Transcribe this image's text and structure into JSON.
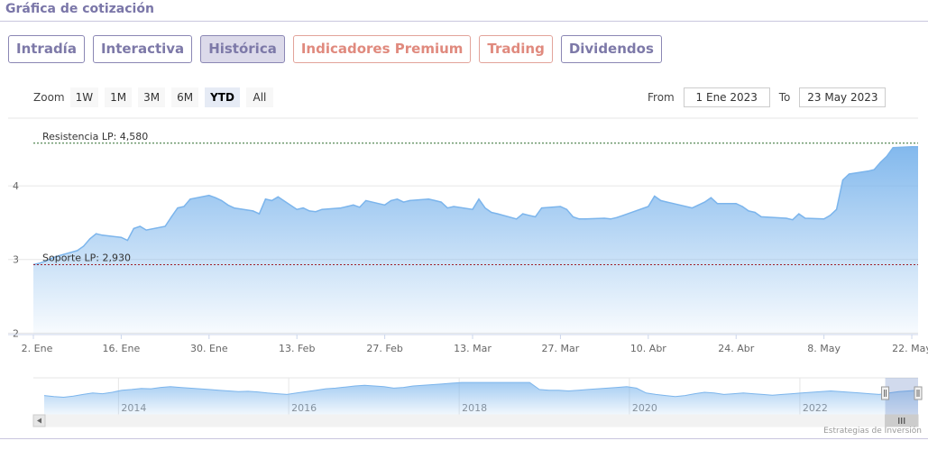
{
  "header": {
    "title": "Gráfica de cotización"
  },
  "tabs": [
    {
      "label": "Intradía",
      "active": false,
      "premium": false
    },
    {
      "label": "Interactiva",
      "active": false,
      "premium": false
    },
    {
      "label": "Histórica",
      "active": true,
      "premium": false
    },
    {
      "label": "Indicadores Premium",
      "active": false,
      "premium": true
    },
    {
      "label": "Trading",
      "active": false,
      "premium": true
    },
    {
      "label": "Dividendos",
      "active": false,
      "premium": false
    }
  ],
  "range_selector": {
    "zoom_label": "Zoom",
    "buttons": [
      "1W",
      "1M",
      "3M",
      "6M",
      "YTD",
      "All"
    ],
    "selected": "YTD",
    "from_label": "From",
    "from_value": "1 Ene 2023",
    "to_label": "To",
    "to_value": "23 May 2023"
  },
  "colors": {
    "line": "#7cb5ec",
    "support": "#a0202a",
    "resistance": "#2f6b2f",
    "accent": "#7d79a8",
    "premium": "#e08a7e"
  },
  "chart_data": {
    "type": "area",
    "x_dates": [
      "2023-01-02",
      "2023-01-03",
      "2023-01-04",
      "2023-01-05",
      "2023-01-06",
      "2023-01-09",
      "2023-01-10",
      "2023-01-11",
      "2023-01-12",
      "2023-01-13",
      "2023-01-16",
      "2023-01-17",
      "2023-01-18",
      "2023-01-19",
      "2023-01-20",
      "2023-01-23",
      "2023-01-24",
      "2023-01-25",
      "2023-01-26",
      "2023-01-27",
      "2023-01-30",
      "2023-01-31",
      "2023-02-01",
      "2023-02-02",
      "2023-02-03",
      "2023-02-06",
      "2023-02-07",
      "2023-02-08",
      "2023-02-09",
      "2023-02-10",
      "2023-02-13",
      "2023-02-14",
      "2023-02-15",
      "2023-02-16",
      "2023-02-17",
      "2023-02-20",
      "2023-02-21",
      "2023-02-22",
      "2023-02-23",
      "2023-02-24",
      "2023-02-27",
      "2023-02-28",
      "2023-03-01",
      "2023-03-02",
      "2023-03-03",
      "2023-03-06",
      "2023-03-07",
      "2023-03-08",
      "2023-03-09",
      "2023-03-10",
      "2023-03-13",
      "2023-03-14",
      "2023-03-15",
      "2023-03-16",
      "2023-03-17",
      "2023-03-20",
      "2023-03-21",
      "2023-03-22",
      "2023-03-23",
      "2023-03-24",
      "2023-03-27",
      "2023-03-28",
      "2023-03-29",
      "2023-03-30",
      "2023-03-31",
      "2023-04-03",
      "2023-04-04",
      "2023-04-05",
      "2023-04-06",
      "2023-04-10",
      "2023-04-11",
      "2023-04-12",
      "2023-04-13",
      "2023-04-14",
      "2023-04-17",
      "2023-04-18",
      "2023-04-19",
      "2023-04-20",
      "2023-04-21",
      "2023-04-24",
      "2023-04-25",
      "2023-04-26",
      "2023-04-27",
      "2023-04-28",
      "2023-05-02",
      "2023-05-03",
      "2023-05-04",
      "2023-05-05",
      "2023-05-08",
      "2023-05-09",
      "2023-05-10",
      "2023-05-11",
      "2023-05-12",
      "2023-05-15",
      "2023-05-16",
      "2023-05-17",
      "2023-05-18",
      "2023-05-19",
      "2023-05-22",
      "2023-05-23"
    ],
    "values": [
      2.93,
      2.95,
      2.98,
      3.02,
      3.05,
      3.12,
      3.18,
      3.28,
      3.35,
      3.33,
      3.3,
      3.26,
      3.42,
      3.45,
      3.4,
      3.45,
      3.58,
      3.7,
      3.72,
      3.82,
      3.87,
      3.84,
      3.8,
      3.74,
      3.7,
      3.66,
      3.62,
      3.82,
      3.8,
      3.85,
      3.68,
      3.7,
      3.66,
      3.65,
      3.68,
      3.7,
      3.72,
      3.74,
      3.71,
      3.8,
      3.74,
      3.8,
      3.82,
      3.78,
      3.8,
      3.82,
      3.8,
      3.78,
      3.7,
      3.72,
      3.68,
      3.82,
      3.7,
      3.64,
      3.62,
      3.55,
      3.62,
      3.6,
      3.58,
      3.7,
      3.72,
      3.68,
      3.58,
      3.55,
      3.55,
      3.56,
      3.55,
      3.57,
      3.6,
      3.72,
      3.86,
      3.8,
      3.78,
      3.76,
      3.7,
      3.74,
      3.78,
      3.84,
      3.76,
      3.76,
      3.72,
      3.66,
      3.64,
      3.58,
      3.56,
      3.54,
      3.62,
      3.56,
      3.55,
      3.6,
      3.68,
      4.08,
      4.16,
      4.2,
      4.22,
      4.32,
      4.4,
      4.52,
      4.53,
      4.53
    ],
    "title": "",
    "xlabel": "",
    "ylabel": "",
    "ylim": [
      1.98,
      4.92
    ],
    "yticks": [
      2,
      3,
      4
    ],
    "xticks": [
      {
        "date": "2023-01-02",
        "label": "2. Ene"
      },
      {
        "date": "2023-01-16",
        "label": "16. Ene"
      },
      {
        "date": "2023-01-30",
        "label": "30. Ene"
      },
      {
        "date": "2023-02-13",
        "label": "13. Feb"
      },
      {
        "date": "2023-02-27",
        "label": "27. Feb"
      },
      {
        "date": "2023-03-13",
        "label": "13. Mar"
      },
      {
        "date": "2023-03-27",
        "label": "27. Mar"
      },
      {
        "date": "2023-04-10",
        "label": "10. Abr"
      },
      {
        "date": "2023-04-24",
        "label": "24. Abr"
      },
      {
        "date": "2023-05-08",
        "label": "8. May"
      },
      {
        "date": "2023-05-22",
        "label": "22. May"
      }
    ],
    "x_min_date": "2023-01-02",
    "x_max_date": "2023-05-23",
    "plot_lines": [
      {
        "label": "Resistencia LP: 4,580",
        "value": 4.58,
        "kind": "resistance"
      },
      {
        "label": "Soporte LP: 2,930",
        "value": 2.93,
        "kind": "support"
      }
    ],
    "grid": true,
    "navigator": {
      "years": [
        "2014",
        "2016",
        "2018",
        "2020",
        "2022"
      ],
      "year_dates": [
        "2014-01-01",
        "2016-01-01",
        "2018-01-01",
        "2020-01-01",
        "2022-01-01"
      ],
      "start_date": "2013-01-01",
      "end_date": "2023-05-23",
      "window_start_date": "2023-01-02",
      "window_end_date": "2023-05-23",
      "series": [
        0.55,
        0.52,
        0.5,
        0.53,
        0.58,
        0.62,
        0.6,
        0.64,
        0.7,
        0.72,
        0.75,
        0.74,
        0.78,
        0.8,
        0.78,
        0.76,
        0.74,
        0.72,
        0.7,
        0.68,
        0.66,
        0.67,
        0.65,
        0.62,
        0.6,
        0.58,
        0.62,
        0.66,
        0.7,
        0.74,
        0.76,
        0.79,
        0.82,
        0.84,
        0.82,
        0.8,
        0.76,
        0.78,
        0.82,
        0.84,
        0.86,
        0.88,
        0.9,
        0.92,
        0.92,
        0.92,
        0.92,
        0.92,
        0.92,
        0.92,
        0.92,
        0.72,
        0.7,
        0.7,
        0.68,
        0.7,
        0.72,
        0.74,
        0.76,
        0.78,
        0.8,
        0.76,
        0.62,
        0.58,
        0.55,
        0.52,
        0.55,
        0.6,
        0.64,
        0.62,
        0.58,
        0.6,
        0.62,
        0.6,
        0.58,
        0.56,
        0.58,
        0.6,
        0.62,
        0.64,
        0.66,
        0.68,
        0.66,
        0.64,
        0.62,
        0.6,
        0.58,
        0.62,
        0.66,
        0.68,
        0.7
      ]
    }
  },
  "footer": {
    "credit": "Estrategias de Inversión"
  }
}
